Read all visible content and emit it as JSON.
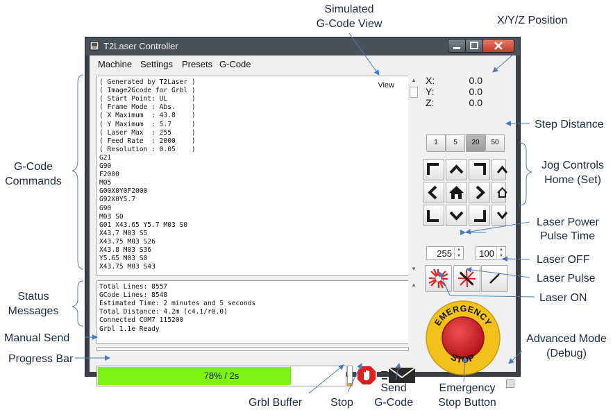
{
  "window": {
    "title": "T2Laser Controller",
    "menu": [
      "Machine",
      "Settings",
      "Presets",
      "G-Code"
    ]
  },
  "gcode": {
    "view_label": "View",
    "lines": [
      "( Generated by T2Laser )",
      "( Image2Gcode for Grbl )",
      "( Start Point: UL      )",
      "( Frame Mode : Abs.    )",
      "( X Maximum  : 43.8    )",
      "( Y Maximum  : 5.7     )",
      "( Laser Max  : 255     )",
      "( Feed Rate  : 2000    )",
      "( Resolution : 0.05    )",
      "G21",
      "G90",
      "F2000",
      "M05",
      "G00X0Y0F2000",
      "G92X0Y5.7",
      "G90",
      "M03 S0",
      "G01 X43.65 Y5.7 M03 S0",
      "X43.7 M03 S5",
      "X43.75 M03 S26",
      "X43.8 M03 S36",
      "Y5.65 M03 S0",
      "X43.75 M03 S43"
    ]
  },
  "status": {
    "lines": [
      "Total Lines: 8557",
      "GCode Lines: 8548",
      "Estimated Time: 2 minutes and 5 seconds",
      "Total Distance: 4.2m (c4.1/r0.0)",
      "Connected COM7 115200",
      "Grbl 1.1e Ready"
    ]
  },
  "progress": {
    "text": "78% / 2s",
    "fraction": 0.78
  },
  "grbl_buffer": {
    "fraction": 0.15
  },
  "position": {
    "x_label": "X:",
    "y_label": "Y:",
    "z_label": "Z:",
    "x": "0.0",
    "y": "0.0",
    "z": "0.0"
  },
  "steps": {
    "options": [
      "1",
      "5",
      "20",
      "50"
    ],
    "selected": "20"
  },
  "laser": {
    "power": "255",
    "pulse_time": "100"
  },
  "colors": {
    "progress": "#7ef20f",
    "buffer": "#f0a030",
    "emergency": "#d9262b",
    "emergency_ring": "#f2c21a",
    "stop_icon": "#e02020"
  },
  "callouts": {
    "simulated_view": [
      "Simulated",
      "G-Code View"
    ],
    "xyz_position": "X/Y/Z Position",
    "gcode_commands": [
      "G-Code",
      "Commands"
    ],
    "step_distance": "Step Distance",
    "jog_controls": [
      "Jog Controls",
      "Home (Set)"
    ],
    "laser_power": "Laser Power",
    "pulse_time": "Pulse Time",
    "laser_off": "Laser OFF",
    "laser_pulse": "Laser Pulse",
    "laser_on": "Laser ON",
    "status_messages": [
      "Status",
      "Messages"
    ],
    "manual_send": "Manual Send",
    "progress_bar": "Progress Bar",
    "advanced_mode": [
      "Advanced Mode",
      "(Debug)"
    ],
    "grbl_buffer": "Grbl Buffer",
    "stop": "Stop",
    "send_gcode": [
      "Send",
      "G-Code"
    ],
    "emergency_stop": [
      "Emergency",
      "Stop Button"
    ]
  },
  "emergency": {
    "text_top": "EMERGENCY",
    "text_bottom": "STOP"
  },
  "icons": [
    "app-icon",
    "minimize-icon",
    "maximize-icon",
    "close-icon",
    "stop-hand-icon",
    "send-envelope-icon",
    "home-icon",
    "laser-burst-icon",
    "laser-line-icon"
  ]
}
